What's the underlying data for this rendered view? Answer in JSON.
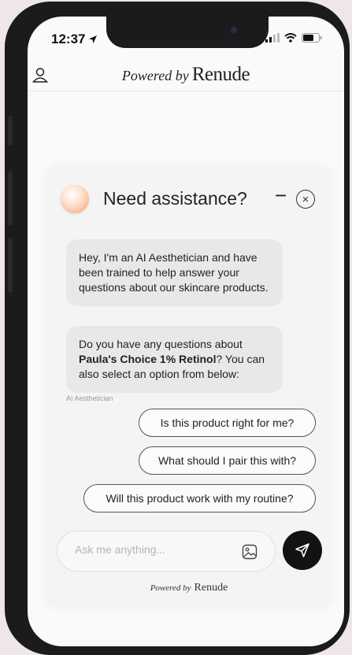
{
  "status": {
    "time": "12:37"
  },
  "header": {
    "powered_by": "Powered by",
    "brand": "Renude"
  },
  "chat": {
    "title": "Need assistance?",
    "minimize_label": "−",
    "close_label": "×",
    "messages": [
      {
        "text": "Hey, I'm an AI Aesthetician and have been trained to help answer your questions about our skincare products."
      },
      {
        "text_before": "Do you have any questions about ",
        "product": "Paula's Choice 1% Retinol",
        "text_after": "? You can also select an option from below:"
      }
    ],
    "sender_label": "AI Aesthetician",
    "options": [
      "Is this product right for me?",
      "What should I pair this with?",
      "Will this product work with my routine?"
    ],
    "input_placeholder": "Ask me anything...",
    "footer_powered_by": "Powered by",
    "footer_brand": "Renude"
  }
}
